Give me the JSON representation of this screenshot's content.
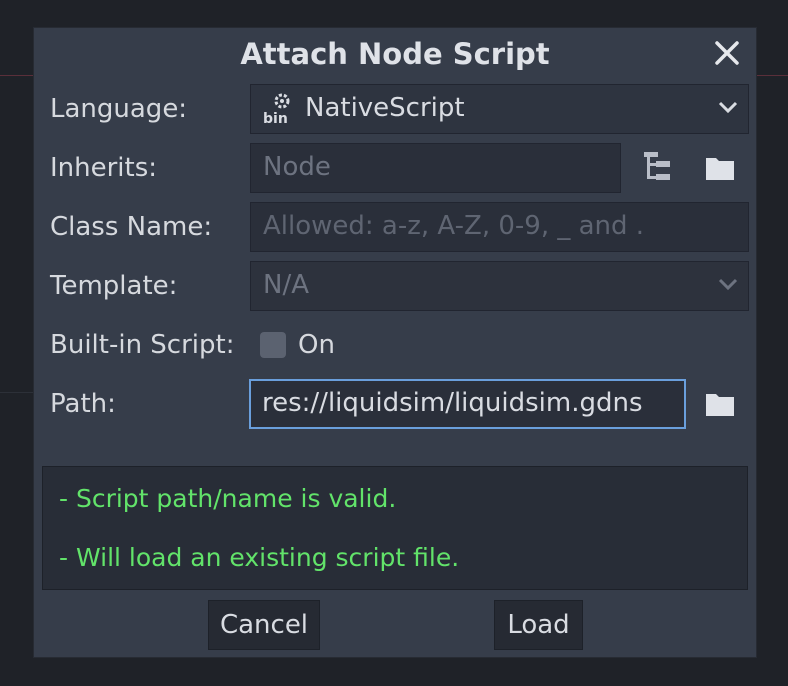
{
  "dialog": {
    "title": "Attach Node Script",
    "icons": {
      "close": "close-icon"
    }
  },
  "form": {
    "language": {
      "label": "Language:",
      "value": "NativeScript",
      "icon": "nativescript-icon"
    },
    "inherits": {
      "label": "Inherits:",
      "placeholder": "Node"
    },
    "class_name": {
      "label": "Class Name:",
      "placeholder": "Allowed: a-z, A-Z, 0-9, _ and ."
    },
    "template": {
      "label": "Template:",
      "value": "N/A"
    },
    "builtin": {
      "label": "Built-in Script:",
      "checkbox_label": "On",
      "checked": false
    },
    "path": {
      "label": "Path:",
      "value": "res://liquidsim/liquidsim.gdns"
    }
  },
  "messages": [
    "- Script path/name is valid.",
    "- Will load an existing script file."
  ],
  "buttons": {
    "cancel": "Cancel",
    "load": "Load"
  },
  "colors": {
    "accent": "#6a9fdc",
    "success": "#62e36a",
    "panel": "#363d4a"
  }
}
